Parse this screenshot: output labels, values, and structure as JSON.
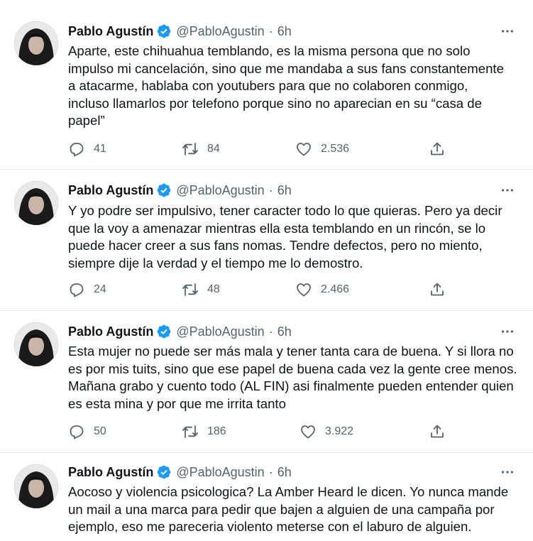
{
  "tweets": [
    {
      "author": "Pablo Agustín",
      "handle": "@PabloAgustin",
      "separator": "·",
      "time": "6h",
      "text": "Aparte, este chihuahua temblando, es la misma persona que no solo\nimpulso mi cancelación, sino que me mandaba a sus fans constantemente\na atacarme, hablaba con youtubers para que no colaboren conmigo,\nincluso llamarlos por telefono porque sino no aparecian en su “casa de\npapel”",
      "replies": "41",
      "retweets": "84",
      "likes": "2.536"
    },
    {
      "author": "Pablo Agustín",
      "handle": "@PabloAgustin",
      "separator": "·",
      "time": "6h",
      "text": "Y yo podre ser impulsivo, tener caracter todo lo que quieras. Pero ya decir\nque la voy a amenazar mientras ella esta temblando en un rincón, se lo\npuede hacer creer a sus fans nomas. Tendre defectos, pero no miento,\nsiempre dije la verdad y el tiempo me lo demostro.",
      "replies": "24",
      "retweets": "48",
      "likes": "2.466"
    },
    {
      "author": "Pablo Agustín",
      "handle": "@PabloAgustin",
      "separator": "·",
      "time": "6h",
      "text": "Esta mujer no puede ser más mala y tener tanta cara de buena. Y si llora no\nes por mis tuits, sino que ese papel de buena cada vez la gente cree menos.\nMañana grabo y cuento todo (AL FIN) asi finalmente pueden entender quien\nes esta mina y por que me irrita tanto",
      "replies": "50",
      "retweets": "186",
      "likes": "3.922"
    },
    {
      "author": "Pablo Agustín",
      "handle": "@PabloAgustin",
      "separator": "·",
      "time": "6h",
      "text": "Aocoso y violencia psicologica? La Amber Heard le dicen. Yo nunca mande\nun mail a una marca para pedir que bajen a alguien de una campaña por\nejemplo, eso me pareceria violento meterse con el laburo de alguien.",
      "replies": "",
      "retweets": "",
      "likes": ""
    }
  ],
  "icons": {
    "reply": "reply-icon",
    "retweet": "retweet-icon",
    "like": "like-icon",
    "share": "share-icon",
    "more": "more-icon",
    "verified": "verified-badge-icon"
  },
  "colors": {
    "verified": "#1d9bf0",
    "secondary_text": "#536471",
    "divider": "#e6ecf0"
  }
}
